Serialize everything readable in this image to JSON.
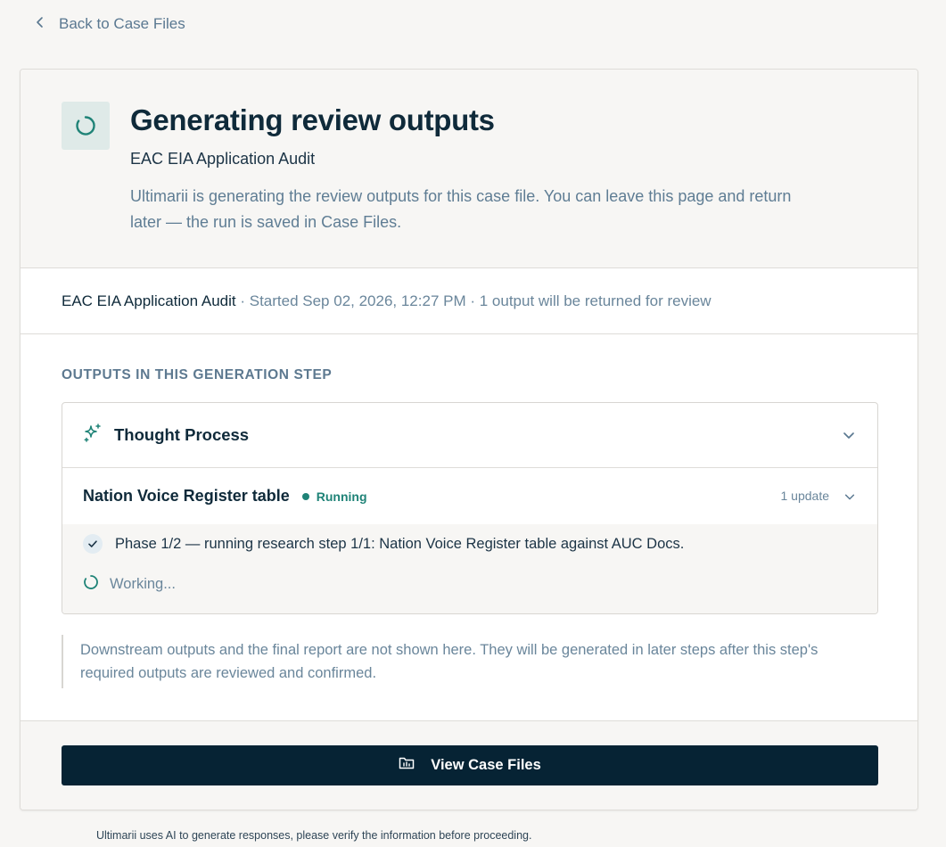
{
  "nav": {
    "back_label": "Back to Case Files"
  },
  "hero": {
    "title": "Generating review outputs",
    "subtitle": "EAC EIA Application Audit",
    "description": "Ultimarii is generating the review outputs for this case file. You can leave this page and return later — the run is saved in Case Files."
  },
  "meta": {
    "case_name": "EAC EIA Application Audit",
    "details": " · Started Sep 02, 2026, 12:27 PM · 1 output will be returned for review"
  },
  "outputs": {
    "section_label": "OUTPUTS IN THIS GENERATION STEP",
    "panel_title": "Thought Process",
    "task": {
      "name": "Nation Voice Register table",
      "status": "Running",
      "updates": "1 update",
      "steps": [
        {
          "text": "Phase 1/2 — running research step 1/1: Nation Voice Register table against AUC Docs.",
          "done": true
        }
      ],
      "working_label": "Working..."
    }
  },
  "note": "Downstream outputs and the final report are not shown here. They will be generated in later steps after this step's required outputs are reviewed and confirmed.",
  "actions": {
    "view_case_files_label": "View Case Files"
  },
  "disclaimer": "Ultimarii uses AI to generate responses, please verify the information before proceeding.",
  "colors": {
    "accent": "#1f8377",
    "primary_button": "#062334",
    "background": "#f7f6f4"
  },
  "icons": {
    "back": "chevron-left-icon",
    "hero": "spinner-icon",
    "thought_process": "sparkles-icon",
    "expand": "chevron-down-icon",
    "step_done": "check-icon",
    "working": "spinner-icon",
    "view_case_files": "folder-icon"
  }
}
